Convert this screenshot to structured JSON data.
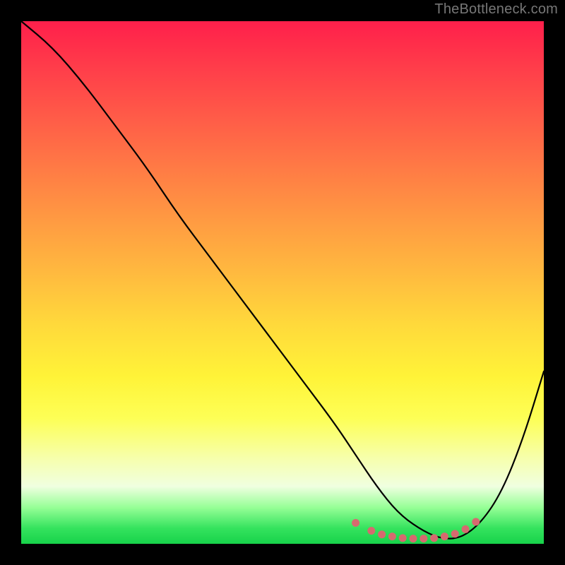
{
  "watermark": "TheBottleneck.com",
  "chart_data": {
    "type": "line",
    "title": "",
    "xlabel": "",
    "ylabel": "",
    "xlim": [
      0,
      100
    ],
    "ylim": [
      0,
      100
    ],
    "grid": false,
    "background_gradient": {
      "direction": "top-to-bottom",
      "stops": [
        {
          "pos": 0,
          "color": "#ff1f4b"
        },
        {
          "pos": 50,
          "color": "#ffd93b"
        },
        {
          "pos": 90,
          "color": "#f0ffe0"
        },
        {
          "pos": 100,
          "color": "#17d24a"
        }
      ]
    },
    "series": [
      {
        "name": "bottleneck-curve",
        "color": "#000000",
        "x": [
          0,
          6,
          12,
          18,
          24,
          30,
          36,
          42,
          48,
          54,
          60,
          64,
          68,
          72,
          76,
          80,
          84,
          88,
          92,
          96,
          100
        ],
        "y": [
          100,
          95,
          88,
          80,
          72,
          63,
          55,
          47,
          39,
          31,
          23,
          17,
          11,
          6,
          3,
          1,
          1,
          4,
          10,
          20,
          33
        ]
      }
    ],
    "bottom_markers": {
      "name": "optimal-range-dots",
      "color": "#d66a6f",
      "points": [
        {
          "x": 64,
          "y": 4.0
        },
        {
          "x": 67,
          "y": 2.5
        },
        {
          "x": 69,
          "y": 1.8
        },
        {
          "x": 71,
          "y": 1.4
        },
        {
          "x": 73,
          "y": 1.1
        },
        {
          "x": 75,
          "y": 1.0
        },
        {
          "x": 77,
          "y": 1.0
        },
        {
          "x": 79,
          "y": 1.1
        },
        {
          "x": 81,
          "y": 1.4
        },
        {
          "x": 83,
          "y": 1.9
        },
        {
          "x": 85,
          "y": 2.8
        },
        {
          "x": 87,
          "y": 4.2
        }
      ]
    }
  }
}
